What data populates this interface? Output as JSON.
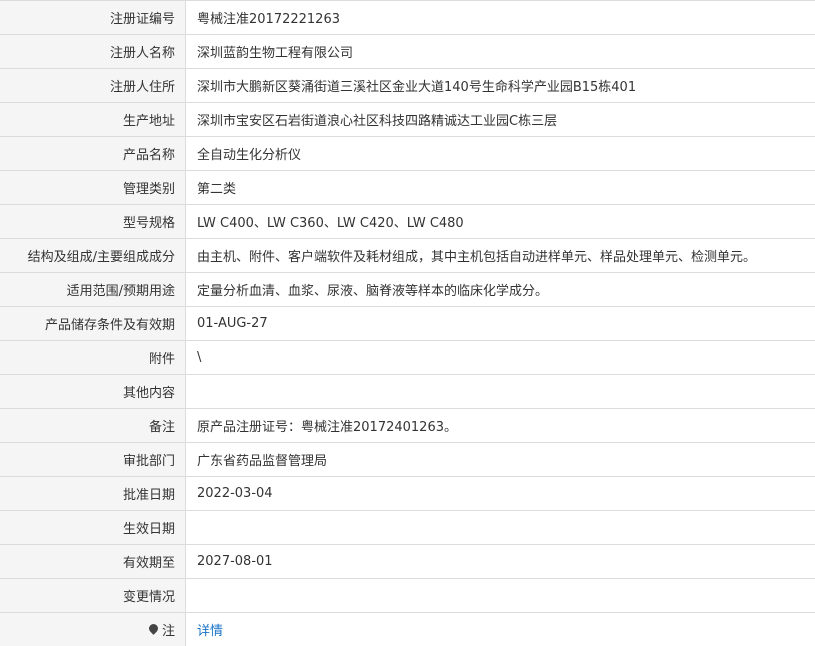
{
  "rows": [
    {
      "key": "reg_no",
      "label": "注册证编号",
      "value": "粤械注准20172221263"
    },
    {
      "key": "registrant_name",
      "label": "注册人名称",
      "value": "深圳蓝韵生物工程有限公司"
    },
    {
      "key": "registrant_address",
      "label": "注册人住所",
      "value": "深圳市大鹏新区葵涌街道三溪社区金业大道140号生命科学产业园B15栋401"
    },
    {
      "key": "production_address",
      "label": "生产地址",
      "value": "深圳市宝安区石岩街道浪心社区科技四路精诚达工业园C栋三层"
    },
    {
      "key": "product_name",
      "label": "产品名称",
      "value": "全自动生化分析仪"
    },
    {
      "key": "category",
      "label": "管理类别",
      "value": "第二类"
    },
    {
      "key": "model",
      "label": "型号规格",
      "value": "LW C400、LW C360、LW C420、LW C480"
    },
    {
      "key": "structure",
      "label": "结构及组成/主要组成成分",
      "value": "由主机、附件、客户端软件及耗材组成，其中主机包括自动进样单元、样品处理单元、检测单元。"
    },
    {
      "key": "intended_use",
      "label": "适用范围/预期用途",
      "value": "定量分析血清、血浆、尿液、脑脊液等样本的临床化学成分。"
    },
    {
      "key": "storage",
      "label": "产品储存条件及有效期",
      "value": "01-AUG-27"
    },
    {
      "key": "attachment",
      "label": "附件",
      "value": "\\"
    },
    {
      "key": "other",
      "label": "其他内容",
      "value": ""
    },
    {
      "key": "remarks",
      "label": "备注",
      "value": "原产品注册证号：粤械注准20172401263。"
    },
    {
      "key": "approval_dept",
      "label": "审批部门",
      "value": "广东省药品监督管理局"
    },
    {
      "key": "approval_date",
      "label": "批准日期",
      "value": "2022-03-04"
    },
    {
      "key": "effective_date",
      "label": "生效日期",
      "value": ""
    },
    {
      "key": "valid_until",
      "label": "有效期至",
      "value": "2027-08-01"
    },
    {
      "key": "changes",
      "label": "变更情况",
      "value": ""
    }
  ],
  "note_row": {
    "label": "注",
    "pin_icon": "map-pin-icon",
    "link_text": "详情"
  }
}
